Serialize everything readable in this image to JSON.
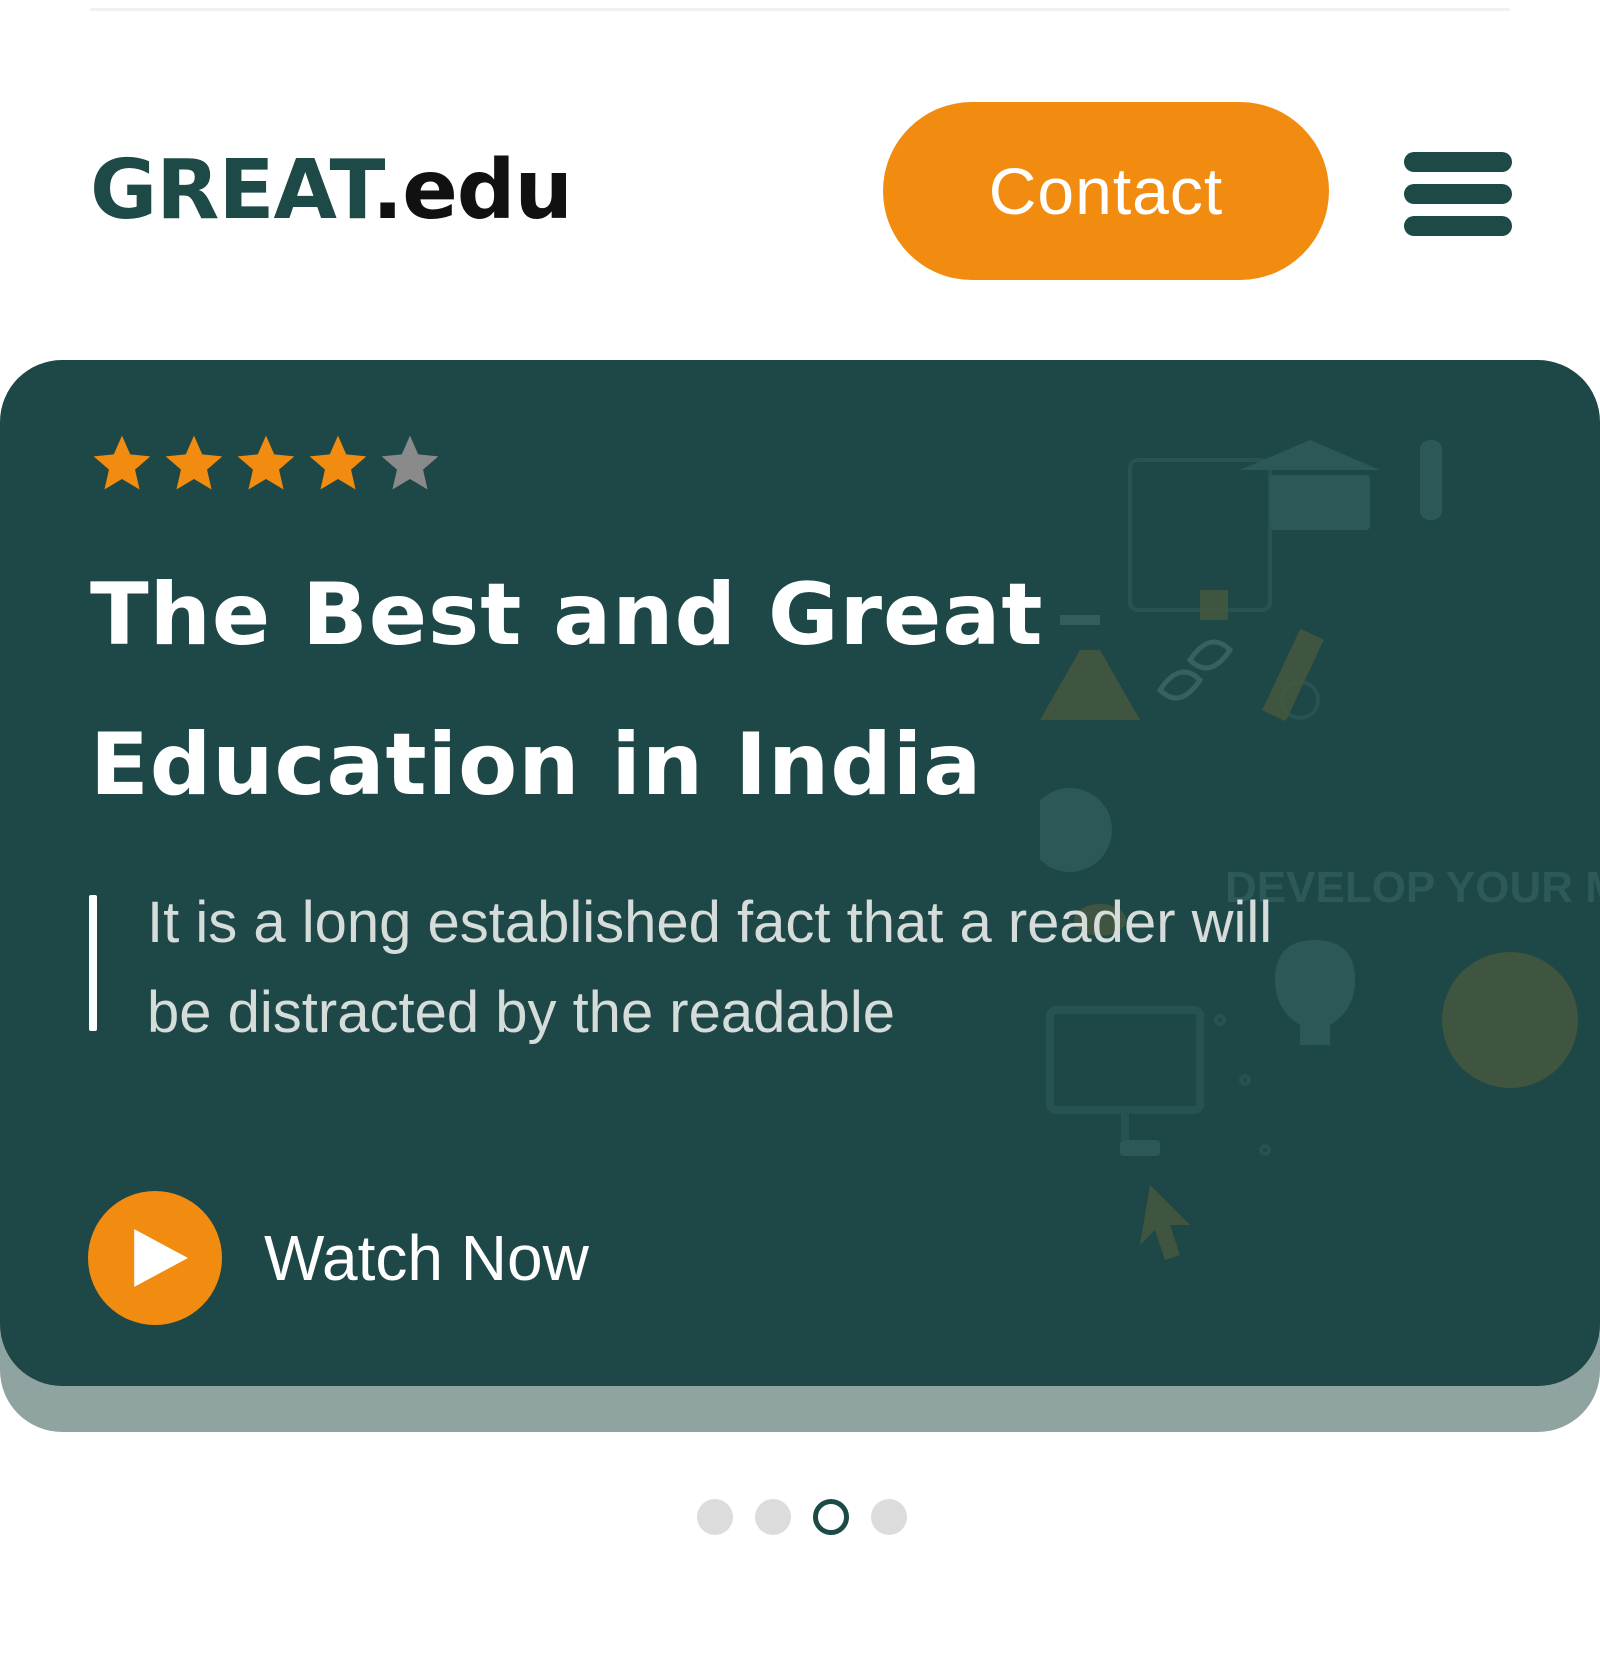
{
  "header": {
    "logo_brand": "GREAT",
    "logo_tld": ".edu",
    "contact_label": "Contact",
    "menu_icon": "hamburger-menu-icon"
  },
  "hero": {
    "rating": {
      "value": 4,
      "max": 5
    },
    "title": "The Best and Great Education in India",
    "description": "It is a long established fact that a reader will be distracted by the readable",
    "watch_label": "Watch Now",
    "play_icon": "play-icon",
    "background_text": "DEVELOP YOUR MIN"
  },
  "carousel": {
    "slide_count": 4,
    "active_index": 2
  },
  "colors": {
    "accent_orange": "#f28c10",
    "brand_green": "#1d4a47",
    "card_background": "#1e4747",
    "card_shadow": "#8fa4a1",
    "star_inactive": "#8a8a8a",
    "dot_inactive": "#dcdcdc"
  }
}
